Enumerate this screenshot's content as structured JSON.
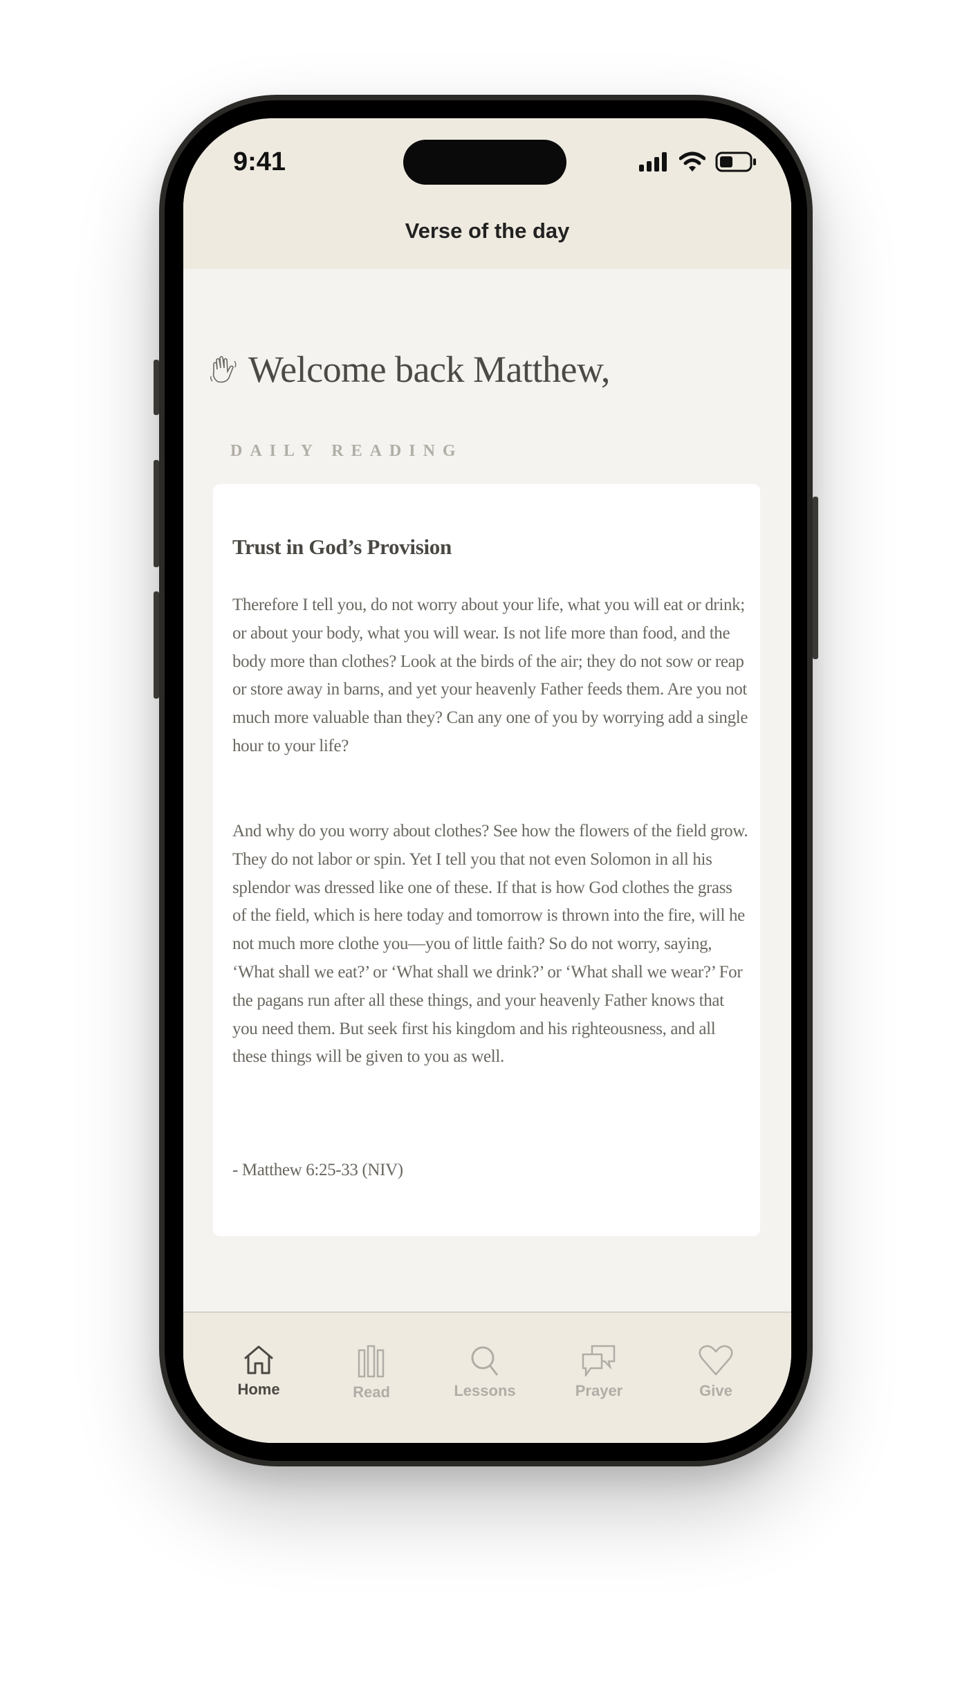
{
  "status_bar": {
    "time": "9:41"
  },
  "header": {
    "title": "Verse of the day"
  },
  "welcome": {
    "text": "Welcome back Matthew,",
    "icon": "waving-hand-icon"
  },
  "section_label": "DAILY READING",
  "reading": {
    "title": "Trust in God’s Provision",
    "paragraphs": [
      "Therefore I tell you, do not worry about your life, what you will eat or drink; or about your body, what you will wear. Is not life more than food, and the body more than clothes? Look at the birds of the air; they do not sow or reap or store away in barns, and yet your heavenly Father feeds them. Are you not much more valuable than they? Can any one of you by worrying add a single hour to your life?",
      "And why do you worry about clothes? See how the flowers of the field grow. They do not labor or spin. Yet I tell you that not even Solomon in all his splendor was dressed like one of these. If that is how God clothes the grass of the field, which is here today and tomorrow is thrown into the fire, will he not much more clothe you—you of little faith? So do not worry, saying, ‘What shall we eat?’ or ‘What shall we drink?’ or ‘What shall we wear?’ For the pagans run after all these things, and your heavenly Father knows that you need them. But seek first his kingdom and his righteousness, and all these things will be given to you as well."
    ],
    "reference": "- Matthew 6:25-33 (NIV)"
  },
  "tabs": [
    {
      "label": "Home",
      "icon": "home-icon",
      "active": true
    },
    {
      "label": "Read",
      "icon": "books-icon",
      "active": false
    },
    {
      "label": "Lessons",
      "icon": "search-icon",
      "active": false
    },
    {
      "label": "Prayer",
      "icon": "chat-bubbles-icon",
      "active": false
    },
    {
      "label": "Give",
      "icon": "heart-icon",
      "active": false
    }
  ],
  "colors": {
    "header_bg": "#eeeae0",
    "page_bg": "#f4f3ef",
    "active_tab": "#4a4843",
    "inactive_tab": "#b0ada6"
  }
}
